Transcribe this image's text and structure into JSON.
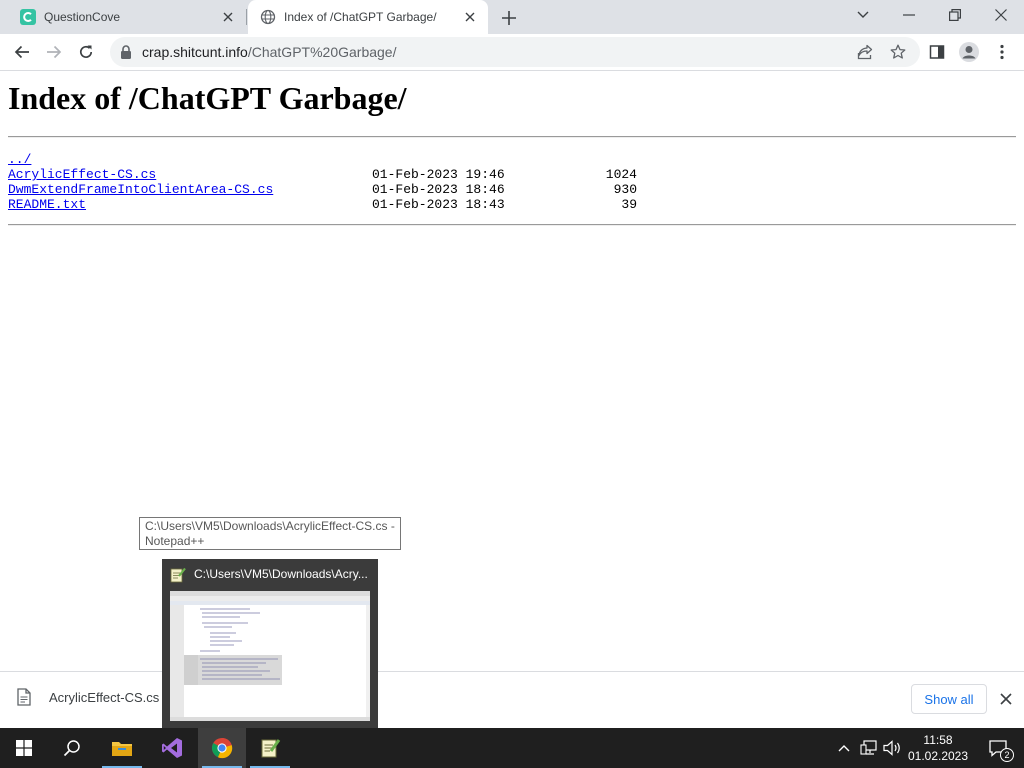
{
  "browser": {
    "tabs": [
      {
        "title": "QuestionCove",
        "active": false,
        "favicon": "questioncove-icon"
      },
      {
        "title": "Index of /ChatGPT Garbage/",
        "active": true,
        "favicon": "globe-icon"
      }
    ],
    "address": {
      "host": "crap.shitcunt.info",
      "path": "/ChatGPT%20Garbage/"
    }
  },
  "page": {
    "heading": "Index of /ChatGPT Garbage/",
    "parent_link": "../",
    "files": [
      {
        "name": "AcrylicEffect-CS.cs",
        "date": "01-Feb-2023 19:46",
        "size": "1024"
      },
      {
        "name": "DwmExtendFrameIntoClientArea-CS.cs",
        "date": "01-Feb-2023 18:46",
        "size": "930"
      },
      {
        "name": "README.txt",
        "date": "01-Feb-2023 18:43",
        "size": "39"
      }
    ]
  },
  "tooltip": {
    "text": "C:\\Users\\VM5\\Downloads\\AcrylicEffect-CS.cs - Notepad++"
  },
  "thumbnail": {
    "title": "C:\\Users\\VM5\\Downloads\\Acry..."
  },
  "download_shelf": {
    "file_name": "AcrylicEffect-CS.cs",
    "show_all_label": "Show all"
  },
  "taskbar": {
    "time": "11:58",
    "date": "01.02.2023",
    "notification_count": "2"
  },
  "colors": {
    "link": "#0000ee",
    "tab_strip": "#dee1e6",
    "taskbar": "#1f1f1f",
    "accent": "#1a73e8"
  }
}
